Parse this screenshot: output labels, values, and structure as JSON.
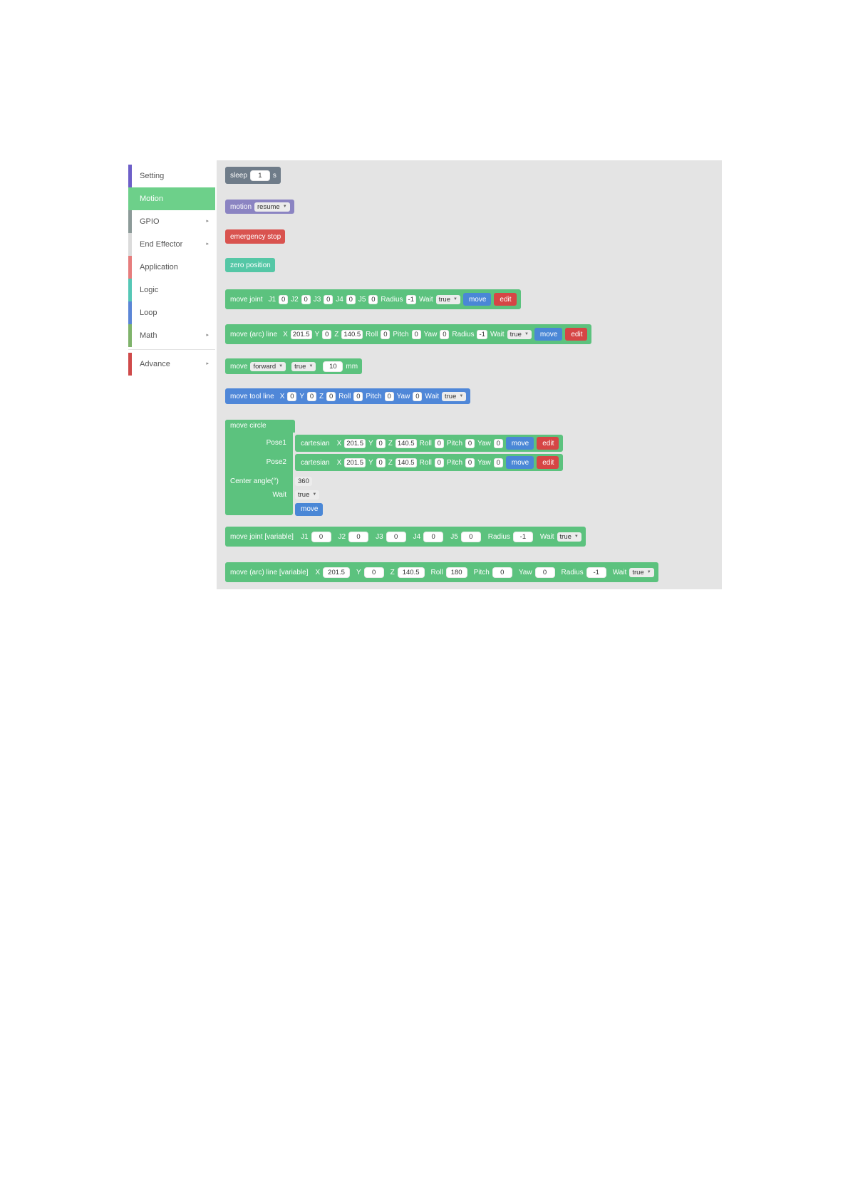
{
  "colors": {
    "setting": "#6d5fc8",
    "motion": "#6dd08a",
    "gpio": "#8c9a98",
    "end_effector": "#dbdbdb",
    "application": "#e67d7d",
    "logic": "#55c7b6",
    "loop": "#5b86d6",
    "math": "#7fb36b",
    "advance": "#cf4a4a",
    "sleep_block": "#6f7c89",
    "motion_block": "#8b84c2",
    "stop_block": "#d9534f",
    "zero_block": "#55c7a6",
    "motion_green": "#5cc27e",
    "tool_block": "#4f87d8",
    "move_btn": "#4a87d6",
    "edit_btn": "#d64545"
  },
  "sidebar": {
    "categories": [
      {
        "label": "Setting",
        "has_arrow": false
      },
      {
        "label": "Motion",
        "has_arrow": false,
        "selected": true
      },
      {
        "label": "GPIO",
        "has_arrow": true
      },
      {
        "label": "End Effector",
        "has_arrow": true
      },
      {
        "label": "Application",
        "has_arrow": false
      },
      {
        "label": "Logic",
        "has_arrow": false
      },
      {
        "label": "Loop",
        "has_arrow": false
      },
      {
        "label": "Math",
        "has_arrow": true
      },
      {
        "label": "Advance",
        "has_arrow": true
      }
    ],
    "arrow_glyph": "▸"
  },
  "blocks": {
    "sleep": {
      "label": "sleep",
      "value": "1",
      "unit": "s"
    },
    "motion": {
      "label": "motion",
      "option": "resume"
    },
    "emergency": {
      "label": "emergency stop"
    },
    "zero": {
      "label": "zero position"
    },
    "move_joint": {
      "label": "move joint",
      "j1_label": "J1",
      "j1": "0",
      "j2_label": "J2",
      "j2": "0",
      "j3_label": "J3",
      "j3": "0",
      "j4_label": "J4",
      "j4": "0",
      "j5_label": "J5",
      "j5": "0",
      "radius_label": "Radius",
      "radius": "-1",
      "wait_label": "Wait",
      "wait": "true",
      "move": "move",
      "edit": "edit"
    },
    "move_arc_line": {
      "label": "move (arc) line",
      "x_label": "X",
      "x": "201.5",
      "y_label": "Y",
      "y": "0",
      "z_label": "Z",
      "z": "140.5",
      "roll_label": "Roll",
      "roll": "0",
      "pitch_label": "Pitch",
      "pitch": "0",
      "yaw_label": "Yaw",
      "yaw": "0",
      "radius_label": "Radius",
      "radius": "-1",
      "wait_label": "Wait",
      "wait": "true",
      "move": "move",
      "edit": "edit"
    },
    "move_dir": {
      "label": "move",
      "direction": "forward",
      "relative": "true",
      "distance": "10",
      "unit": "mm"
    },
    "move_tool_line": {
      "label": "move tool line",
      "x_label": "X",
      "x": "0",
      "y_label": "Y",
      "y": "0",
      "z_label": "Z",
      "z": "0",
      "roll_label": "Roll",
      "roll": "0",
      "pitch_label": "Pitch",
      "pitch": "0",
      "yaw_label": "Yaw",
      "yaw": "0",
      "wait_label": "Wait",
      "wait": "true"
    },
    "move_circle": {
      "label": "move circle",
      "pose1_label": "Pose1",
      "pose2_label": "Pose2",
      "center_label": "Center angle(°)",
      "wait_label": "Wait",
      "center_angle": "360",
      "wait": "true",
      "move": "move",
      "pose1": {
        "type": "cartesian",
        "x_label": "X",
        "x": "201.5",
        "y_label": "Y",
        "y": "0",
        "z_label": "Z",
        "z": "140.5",
        "roll_label": "Roll",
        "roll": "0",
        "pitch_label": "Pitch",
        "pitch": "0",
        "yaw_label": "Yaw",
        "yaw": "0",
        "move": "move",
        "edit": "edit"
      },
      "pose2": {
        "type": "cartesian",
        "x_label": "X",
        "x": "201.5",
        "y_label": "Y",
        "y": "0",
        "z_label": "Z",
        "z": "140.5",
        "roll_label": "Roll",
        "roll": "0",
        "pitch_label": "Pitch",
        "pitch": "0",
        "yaw_label": "Yaw",
        "yaw": "0",
        "move": "move",
        "edit": "edit"
      }
    },
    "move_joint_var": {
      "label": "move joint [variable]",
      "j1_label": "J1",
      "j1": "0",
      "j2_label": "J2",
      "j2": "0",
      "j3_label": "J3",
      "j3": "0",
      "j4_label": "J4",
      "j4": "0",
      "j5_label": "J5",
      "j5": "0",
      "radius_label": "Radius",
      "radius": "-1",
      "wait_label": "Wait",
      "wait": "true"
    },
    "move_arc_line_var": {
      "label": "move (arc) line [variable]",
      "x_label": "X",
      "x": "201.5",
      "y_label": "Y",
      "y": "0",
      "z_label": "Z",
      "z": "140.5",
      "roll_label": "Roll",
      "roll": "180",
      "pitch_label": "Pitch",
      "pitch": "0",
      "yaw_label": "Yaw",
      "yaw": "0",
      "radius_label": "Radius",
      "radius": "-1",
      "wait_label": "Wait",
      "wait": "true"
    }
  }
}
